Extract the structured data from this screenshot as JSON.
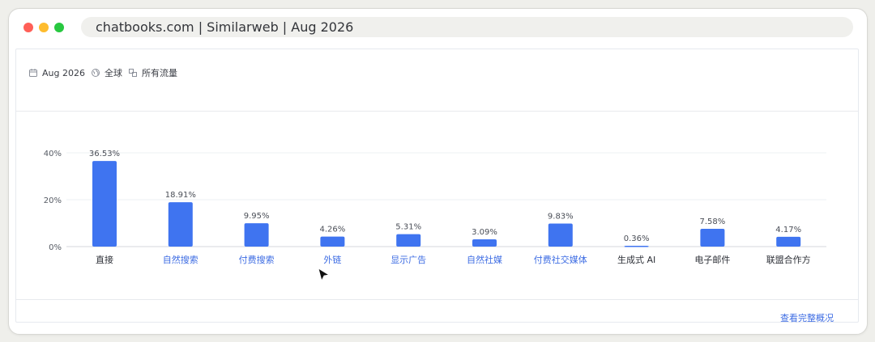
{
  "browser": {
    "title": "chatbooks.com | Similarweb | Aug 2026"
  },
  "filters": {
    "date": "Aug 2026",
    "region": "全球",
    "traffic": "所有流量"
  },
  "footer": {
    "view_full": "查看完整概况"
  },
  "colors": {
    "bar": "#3f74f0",
    "link": "#3d6ce3",
    "label": "#2e3138"
  },
  "chart_data": {
    "type": "bar",
    "categories": [
      "直接",
      "自然搜索",
      "付费搜索",
      "外链",
      "显示广告",
      "自然社媒",
      "付费社交媒体",
      "生成式 AI",
      "电子邮件",
      "联盟合作方"
    ],
    "values": [
      36.53,
      18.91,
      9.95,
      4.26,
      5.31,
      3.09,
      9.83,
      0.36,
      7.58,
      4.17
    ],
    "data_labels": [
      "36.53%",
      "18.91%",
      "9.95%",
      "4.26%",
      "5.31%",
      "3.09%",
      "9.83%",
      "0.36%",
      "7.58%",
      "4.17%"
    ],
    "linked_categories": [
      false,
      true,
      true,
      true,
      true,
      true,
      true,
      false,
      false,
      false
    ],
    "ylim": [
      0,
      40
    ],
    "yticks": [
      0,
      20,
      40
    ],
    "ytick_labels": [
      "0%",
      "20%",
      "40%"
    ],
    "grid": true,
    "legend": "none"
  }
}
